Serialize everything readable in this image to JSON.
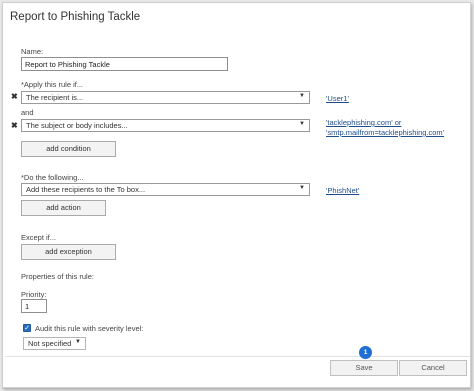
{
  "window": {
    "title": "Report to Phishing Tackle"
  },
  "name_field": {
    "label": "Name:",
    "value": "Report to Phishing Tackle"
  },
  "apply_if": {
    "label": "*Apply this rule if...",
    "conditions": [
      {
        "select": "The recipient is...",
        "links": [
          "'User1'"
        ]
      },
      {
        "select": "The subject or body includes...",
        "links": [
          "'tacklephishing.com' or",
          "'smtp.mailfrom=tacklephishing.com'"
        ]
      }
    ],
    "and_label": "and",
    "add_button": "add condition"
  },
  "do_following": {
    "label": "*Do the following...",
    "action_select": "Add these recipients to the To box...",
    "action_link": "'PhishNet'",
    "add_button": "add action"
  },
  "except_if": {
    "label": "Except if...",
    "add_button": "add exception"
  },
  "properties": {
    "label": "Properties of this rule:",
    "priority_label": "Priority:",
    "priority_value": "1",
    "audit_label": "Audit this rule with severity level:",
    "audit_checked": true,
    "severity_select": "Not specified"
  },
  "footer": {
    "save": "Save",
    "cancel": "Cancel",
    "step_badge": "1"
  },
  "icons": {
    "remove": "x-icon",
    "dropdown": "chevron-down-icon",
    "check": "checkmark-icon"
  },
  "colors": {
    "link": "#1f4e8c",
    "accent": "#1f6ed4"
  }
}
